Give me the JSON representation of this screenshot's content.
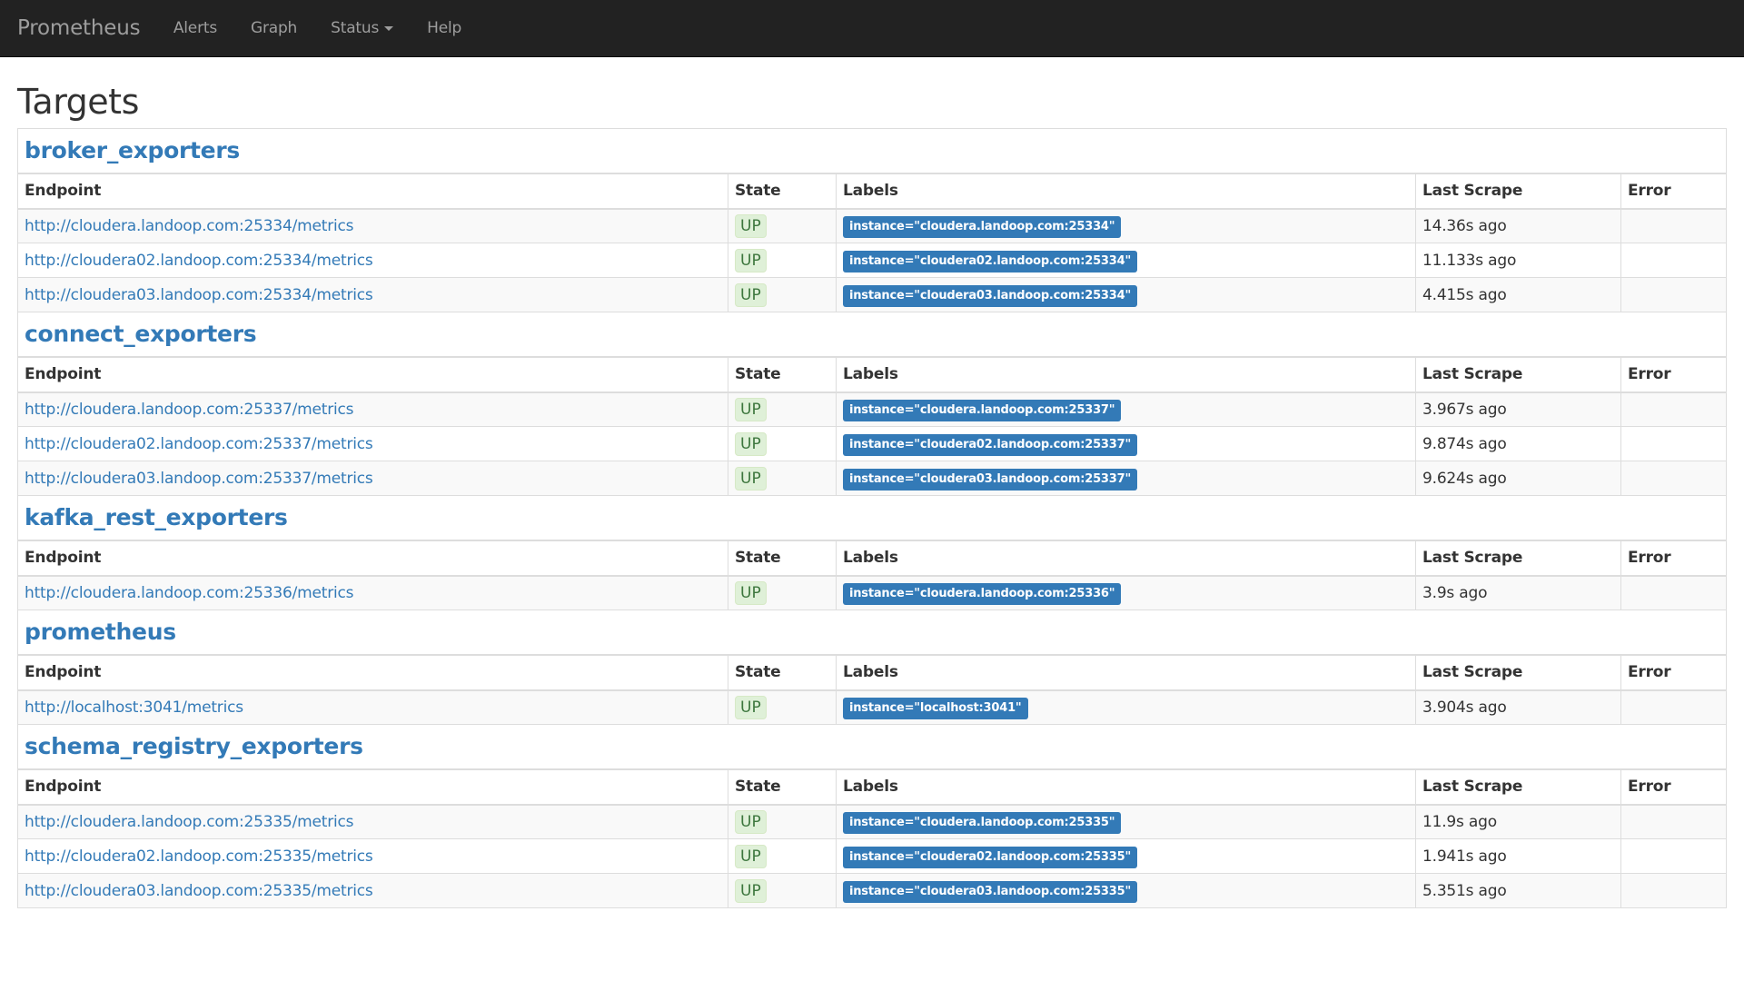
{
  "navbar": {
    "brand": "Prometheus",
    "links": [
      {
        "label": "Alerts",
        "dropdown": false
      },
      {
        "label": "Graph",
        "dropdown": false
      },
      {
        "label": "Status",
        "dropdown": true
      },
      {
        "label": "Help",
        "dropdown": false
      }
    ]
  },
  "page_title": "Targets",
  "columns": {
    "endpoint": "Endpoint",
    "state": "State",
    "labels": "Labels",
    "last_scrape": "Last Scrape",
    "error": "Error"
  },
  "colors": {
    "navbar_bg": "#222222",
    "link": "#337ab7",
    "state_up_bg": "#dff0d8",
    "state_up_text": "#3c763d",
    "label_bg": "#337ab7"
  },
  "jobs": [
    {
      "name": "broker_exporters",
      "targets": [
        {
          "endpoint": "http://cloudera.landoop.com:25334/metrics",
          "state": "UP",
          "labels": "instance=\"cloudera.landoop.com:25334\"",
          "last_scrape": "14.36s ago",
          "error": ""
        },
        {
          "endpoint": "http://cloudera02.landoop.com:25334/metrics",
          "state": "UP",
          "labels": "instance=\"cloudera02.landoop.com:25334\"",
          "last_scrape": "11.133s ago",
          "error": ""
        },
        {
          "endpoint": "http://cloudera03.landoop.com:25334/metrics",
          "state": "UP",
          "labels": "instance=\"cloudera03.landoop.com:25334\"",
          "last_scrape": "4.415s ago",
          "error": ""
        }
      ]
    },
    {
      "name": "connect_exporters",
      "targets": [
        {
          "endpoint": "http://cloudera.landoop.com:25337/metrics",
          "state": "UP",
          "labels": "instance=\"cloudera.landoop.com:25337\"",
          "last_scrape": "3.967s ago",
          "error": ""
        },
        {
          "endpoint": "http://cloudera02.landoop.com:25337/metrics",
          "state": "UP",
          "labels": "instance=\"cloudera02.landoop.com:25337\"",
          "last_scrape": "9.874s ago",
          "error": ""
        },
        {
          "endpoint": "http://cloudera03.landoop.com:25337/metrics",
          "state": "UP",
          "labels": "instance=\"cloudera03.landoop.com:25337\"",
          "last_scrape": "9.624s ago",
          "error": ""
        }
      ]
    },
    {
      "name": "kafka_rest_exporters",
      "targets": [
        {
          "endpoint": "http://cloudera.landoop.com:25336/metrics",
          "state": "UP",
          "labels": "instance=\"cloudera.landoop.com:25336\"",
          "last_scrape": "3.9s ago",
          "error": ""
        }
      ]
    },
    {
      "name": "prometheus",
      "targets": [
        {
          "endpoint": "http://localhost:3041/metrics",
          "state": "UP",
          "labels": "instance=\"localhost:3041\"",
          "last_scrape": "3.904s ago",
          "error": ""
        }
      ]
    },
    {
      "name": "schema_registry_exporters",
      "targets": [
        {
          "endpoint": "http://cloudera.landoop.com:25335/metrics",
          "state": "UP",
          "labels": "instance=\"cloudera.landoop.com:25335\"",
          "last_scrape": "11.9s ago",
          "error": ""
        },
        {
          "endpoint": "http://cloudera02.landoop.com:25335/metrics",
          "state": "UP",
          "labels": "instance=\"cloudera02.landoop.com:25335\"",
          "last_scrape": "1.941s ago",
          "error": ""
        },
        {
          "endpoint": "http://cloudera03.landoop.com:25335/metrics",
          "state": "UP",
          "labels": "instance=\"cloudera03.landoop.com:25335\"",
          "last_scrape": "5.351s ago",
          "error": ""
        }
      ]
    }
  ]
}
